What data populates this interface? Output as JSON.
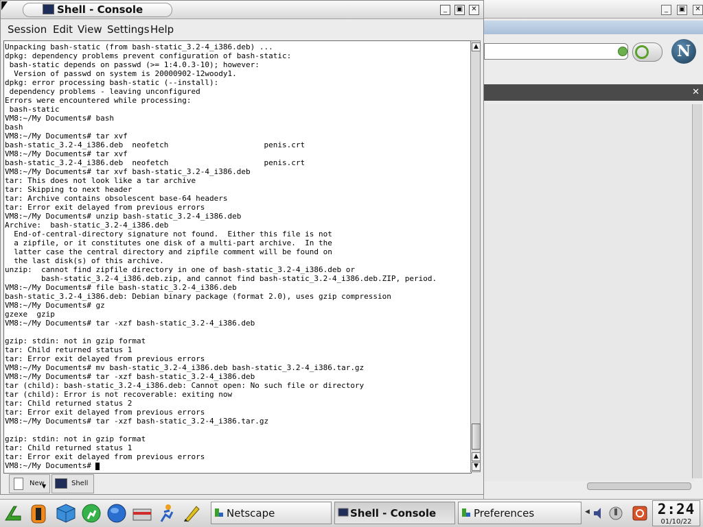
{
  "window": {
    "title": "Shell - Console",
    "buttons": {
      "minimize": "_",
      "maximize": "▣",
      "close": "✕"
    }
  },
  "menu": [
    "Session",
    "Edit",
    "View",
    "Settings",
    "Help"
  ],
  "terminal": {
    "lines": [
      "Unpacking bash-static (from bash-static_3.2-4_i386.deb) ...",
      "dpkg: dependency problems prevent configuration of bash-static:",
      " bash-static depends on passwd (>= 1:4.0.3-10); however:",
      "  Version of passwd on system is 20000902-12woody1.",
      "dpkg: error processing bash-static (--install):",
      " dependency problems - leaving unconfigured",
      "Errors were encountered while processing:",
      " bash-static",
      "VM8:~/My Documents# bash",
      "bash",
      "VM8:~/My Documents# tar xvf",
      "bash-static_3.2-4_i386.deb  neofetch                     penis.crt",
      "VM8:~/My Documents# tar xvf",
      "bash-static_3.2-4_i386.deb  neofetch                     penis.crt",
      "VM8:~/My Documents# tar xvf bash-static_3.2-4_i386.deb",
      "tar: This does not look like a tar archive",
      "tar: Skipping to next header",
      "tar: Archive contains obsolescent base-64 headers",
      "tar: Error exit delayed from previous errors",
      "VM8:~/My Documents# unzip bash-static_3.2-4_i386.deb",
      "Archive:  bash-static_3.2-4_i386.deb",
      "  End-of-central-directory signature not found.  Either this file is not",
      "  a zipfile, or it constitutes one disk of a multi-part archive.  In the",
      "  latter case the central directory and zipfile comment will be found on",
      "  the last disk(s) of this archive.",
      "unzip:  cannot find zipfile directory in one of bash-static_3.2-4_i386.deb or",
      "        bash-static_3.2-4_i386.deb.zip, and cannot find bash-static_3.2-4_i386.deb.ZIP, period.",
      "VM8:~/My Documents# file bash-static_3.2-4_i386.deb",
      "bash-static_3.2-4_i386.deb: Debian binary package (format 2.0), uses gzip compression",
      "VM8:~/My Documents# gz",
      "gzexe  gzip",
      "VM8:~/My Documents# tar -xzf bash-static_3.2-4_i386.deb",
      "",
      "gzip: stdin: not in gzip format",
      "tar: Child returned status 1",
      "tar: Error exit delayed from previous errors",
      "VM8:~/My Documents# mv bash-static_3.2-4_i386.deb bash-static_3.2-4_i386.tar.gz",
      "VM8:~/My Documents# tar -xzf bash-static_3.2-4_i386.deb",
      "tar (child): bash-static_3.2-4_i386.deb: Cannot open: No such file or directory",
      "tar (child): Error is not recoverable: exiting now",
      "tar: Child returned status 2",
      "tar: Error exit delayed from previous errors",
      "VM8:~/My Documents# tar -xzf bash-static_3.2-4_i386.tar.gz",
      "",
      "gzip: stdin: not in gzip format",
      "tar: Child returned status 1",
      "tar: Error exit delayed from previous errors"
    ],
    "prompt": "VM8:~/My Documents# "
  },
  "tabs": {
    "new_label": "New",
    "shell_label": "Shell"
  },
  "taskbar": {
    "tasks": [
      {
        "label": "Netscape",
        "active": false
      },
      {
        "label": "Shell - Console",
        "active": true
      },
      {
        "label": "Preferences",
        "active": false
      }
    ],
    "clock_time": "2:24",
    "clock_date": "01/10/22",
    "launcher_icons": [
      "kde-menu-icon",
      "life-ring-icon",
      "cube-icon",
      "run-icon",
      "globe-icon",
      "tool-case-icon",
      "runner-icon",
      "paint-icon"
    ]
  },
  "colors": {
    "title_text": "#111111",
    "terminal_bg": "#ffffff",
    "netscape_panel": "#4a4a4a"
  }
}
